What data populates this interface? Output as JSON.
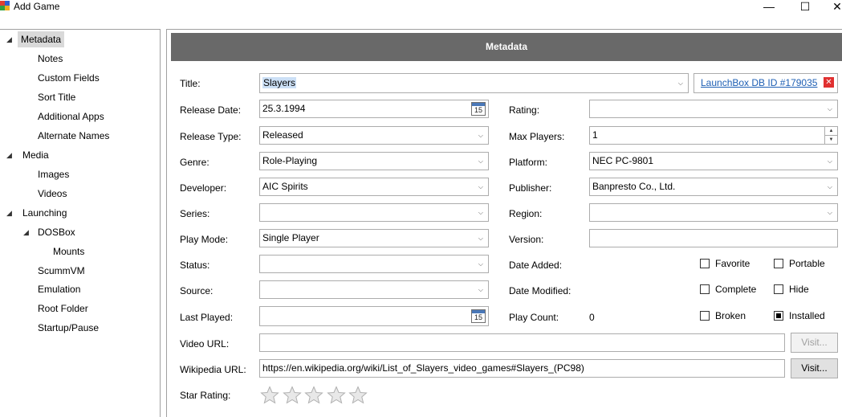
{
  "window": {
    "title": "Add Game"
  },
  "tree": [
    {
      "label": "Metadata",
      "selected": true
    },
    {
      "label": "Notes"
    },
    {
      "label": "Custom Fields"
    },
    {
      "label": "Sort Title"
    },
    {
      "label": "Additional Apps"
    },
    {
      "label": "Alternate Names"
    },
    {
      "label": "Media"
    },
    {
      "label": "Images"
    },
    {
      "label": "Videos"
    },
    {
      "label": "Launching"
    },
    {
      "label": "DOSBox"
    },
    {
      "label": "Mounts"
    },
    {
      "label": "ScummVM"
    },
    {
      "label": "Emulation"
    },
    {
      "label": "Root Folder"
    },
    {
      "label": "Startup/Pause"
    }
  ],
  "header": {
    "title": "Metadata"
  },
  "labels": {
    "title": "Title:",
    "release_date": "Release Date:",
    "release_type": "Release Type:",
    "genre": "Genre:",
    "developer": "Developer:",
    "series": "Series:",
    "play_mode": "Play Mode:",
    "status": "Status:",
    "source": "Source:",
    "last_played": "Last Played:",
    "video_url": "Video URL:",
    "wikipedia_url": "Wikipedia URL:",
    "star_rating": "Star Rating:",
    "rating": "Rating:",
    "max_players": "Max Players:",
    "platform": "Platform:",
    "publisher": "Publisher:",
    "region": "Region:",
    "version": "Version:",
    "date_added": "Date Added:",
    "date_modified": "Date Modified:",
    "play_count": "Play Count:"
  },
  "values": {
    "title": "Slayers",
    "launchbox_link": "LaunchBox DB ID #179035",
    "release_date": "25.3.1994",
    "calendar_day": "15",
    "release_type": "Released",
    "genre": "Role-Playing",
    "developer": "AIC Spirits",
    "series": "",
    "play_mode": "Single Player",
    "status": "",
    "source": "",
    "last_played": "",
    "video_url": "",
    "wikipedia_url": "https://en.wikipedia.org/wiki/List_of_Slayers_video_games#Slayers_(PC98)",
    "rating": "",
    "max_players": "1",
    "platform": "NEC PC-9801",
    "publisher": "Banpresto Co., Ltd.",
    "region": "",
    "version": "",
    "play_count": "0"
  },
  "checkboxes": {
    "favorite": {
      "label": "Favorite",
      "checked": false
    },
    "portable": {
      "label": "Portable",
      "checked": false
    },
    "complete": {
      "label": "Complete",
      "checked": false
    },
    "hide": {
      "label": "Hide",
      "checked": false
    },
    "broken": {
      "label": "Broken",
      "checked": false
    },
    "installed": {
      "label": "Installed",
      "checked": true
    }
  },
  "buttons": {
    "visit_video": "Visit...",
    "visit_wiki": "Visit..."
  },
  "star_rating": 0,
  "icons": {
    "close_window": "✕",
    "maximize": "☐",
    "minimize": "—"
  }
}
